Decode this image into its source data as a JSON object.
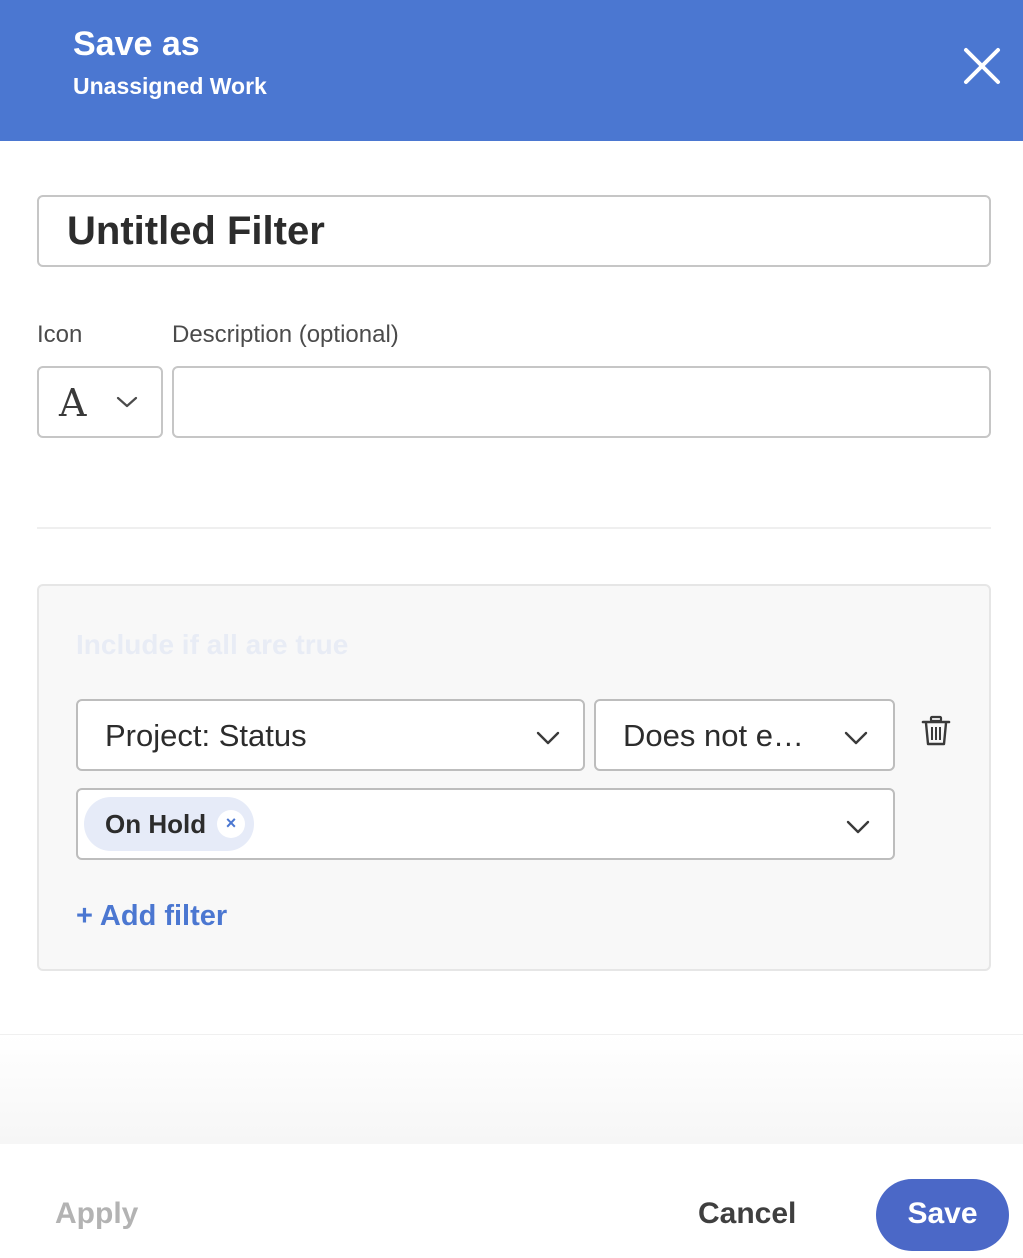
{
  "header": {
    "title": "Save as",
    "subtitle": "Unassigned Work",
    "background_color": "#4b77d1"
  },
  "form": {
    "name_value": "Untitled Filter",
    "icon_label": "Icon",
    "icon_value": "A",
    "description_label": "Description (optional)",
    "description_value": "",
    "description_placeholder": ""
  },
  "filters": {
    "heading": "Include if all are true",
    "rules": [
      {
        "field": "Project: Status",
        "operator": "Does not e…",
        "values": [
          "On Hold"
        ]
      }
    ],
    "add_filter_label": "+ Add filter"
  },
  "footer": {
    "apply_label": "Apply",
    "cancel_label": "Cancel",
    "save_label": "Save",
    "accent_color": "#4b68c7"
  },
  "icons": {
    "close": "close-icon",
    "chevron": "chevron-down-icon",
    "trash": "trash-icon",
    "tag_remove": "remove-tag-icon"
  }
}
